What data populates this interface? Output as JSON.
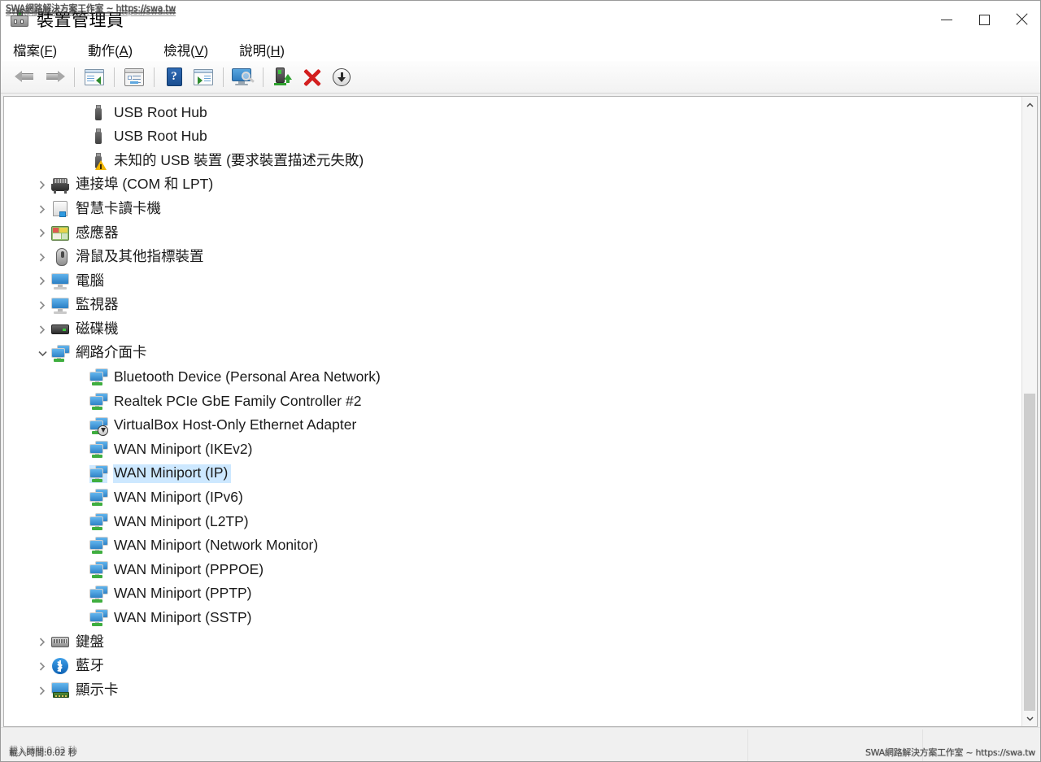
{
  "window": {
    "title": "裝置管理員",
    "icon": "device-manager-icon",
    "controls": {
      "minimize": "—",
      "maximize": "□",
      "close": "✕"
    }
  },
  "menubar": {
    "items": [
      {
        "label": "檔案",
        "accesskey": "F"
      },
      {
        "label": "動作",
        "accesskey": "A"
      },
      {
        "label": "檢視",
        "accesskey": "V"
      },
      {
        "label": "說明",
        "accesskey": "H"
      }
    ]
  },
  "toolbar": {
    "buttons": [
      {
        "name": "back-button",
        "icon": "back-arrow-icon"
      },
      {
        "name": "forward-button",
        "icon": "forward-arrow-icon"
      },
      {
        "name": "show-hide-console-tree",
        "icon": "console-tree-icon"
      },
      {
        "name": "properties-button",
        "icon": "properties-icon"
      },
      {
        "name": "help-button",
        "icon": "help-icon"
      },
      {
        "name": "show-hide-action-pane",
        "icon": "action-pane-icon"
      },
      {
        "name": "scan-hardware-changes",
        "icon": "scan-hardware-icon"
      },
      {
        "name": "update-driver-button",
        "icon": "update-driver-icon"
      },
      {
        "name": "uninstall-device-button",
        "icon": "red-x-icon"
      },
      {
        "name": "disable-device-button",
        "icon": "down-arrow-circle-icon"
      }
    ]
  },
  "tree": {
    "rows": [
      {
        "label": "USB Root Hub",
        "icon": "usb-icon",
        "level": 2,
        "expander": "none",
        "selected": false
      },
      {
        "label": "USB Root Hub",
        "icon": "usb-icon",
        "level": 2,
        "expander": "none",
        "selected": false
      },
      {
        "label": "未知的 USB 裝置 (要求裝置描述元失敗)",
        "icon": "usb-warning-icon",
        "level": 2,
        "expander": "none",
        "selected": false
      },
      {
        "label": "連接埠 (COM 和 LPT)",
        "icon": "port-icon",
        "level": 1,
        "expander": "collapsed",
        "selected": false
      },
      {
        "label": "智慧卡讀卡機",
        "icon": "smartcard-icon",
        "level": 1,
        "expander": "collapsed",
        "selected": false
      },
      {
        "label": "感應器",
        "icon": "sensor-icon",
        "level": 1,
        "expander": "collapsed",
        "selected": false
      },
      {
        "label": "滑鼠及其他指標裝置",
        "icon": "mouse-icon",
        "level": 1,
        "expander": "collapsed",
        "selected": false
      },
      {
        "label": "電腦",
        "icon": "computer-icon",
        "level": 1,
        "expander": "collapsed",
        "selected": false
      },
      {
        "label": "監視器",
        "icon": "monitor-icon",
        "level": 1,
        "expander": "collapsed",
        "selected": false
      },
      {
        "label": "磁碟機",
        "icon": "disk-drive-icon",
        "level": 1,
        "expander": "collapsed",
        "selected": false
      },
      {
        "label": "網路介面卡",
        "icon": "network-icon",
        "level": 1,
        "expander": "expanded",
        "selected": false
      },
      {
        "label": "Bluetooth Device (Personal Area Network)",
        "icon": "network-icon",
        "level": 2,
        "expander": "none",
        "selected": false
      },
      {
        "label": "Realtek PCIe GbE Family Controller #2",
        "icon": "network-icon",
        "level": 2,
        "expander": "none",
        "selected": false
      },
      {
        "label": "VirtualBox Host-Only Ethernet Adapter",
        "icon": "network-disabled-icon",
        "level": 2,
        "expander": "none",
        "selected": false
      },
      {
        "label": "WAN Miniport (IKEv2)",
        "icon": "network-icon",
        "level": 2,
        "expander": "none",
        "selected": false
      },
      {
        "label": "WAN Miniport (IP)",
        "icon": "network-icon",
        "level": 2,
        "expander": "none",
        "selected": true
      },
      {
        "label": "WAN Miniport (IPv6)",
        "icon": "network-icon",
        "level": 2,
        "expander": "none",
        "selected": false
      },
      {
        "label": "WAN Miniport (L2TP)",
        "icon": "network-icon",
        "level": 2,
        "expander": "none",
        "selected": false
      },
      {
        "label": "WAN Miniport (Network Monitor)",
        "icon": "network-icon",
        "level": 2,
        "expander": "none",
        "selected": false
      },
      {
        "label": "WAN Miniport (PPPOE)",
        "icon": "network-icon",
        "level": 2,
        "expander": "none",
        "selected": false
      },
      {
        "label": "WAN Miniport (PPTP)",
        "icon": "network-icon",
        "level": 2,
        "expander": "none",
        "selected": false
      },
      {
        "label": "WAN Miniport (SSTP)",
        "icon": "network-icon",
        "level": 2,
        "expander": "none",
        "selected": false
      },
      {
        "label": "鍵盤",
        "icon": "keyboard-icon",
        "level": 1,
        "expander": "collapsed",
        "selected": false
      },
      {
        "label": "藍牙",
        "icon": "bluetooth-icon",
        "level": 1,
        "expander": "collapsed",
        "selected": false
      },
      {
        "label": "顯示卡",
        "icon": "display-adapter-icon",
        "level": 1,
        "expander": "collapsed",
        "selected": false
      }
    ]
  },
  "scrollbar": {
    "up": "▲",
    "down": "▼"
  },
  "statusbar": {
    "text": ""
  },
  "watermarks": {
    "top": "SWA網路解決方案工作室 ~ https://swa.tw",
    "bottom": "SWA網路解決方案工作室 ~ https://swa.tw",
    "status": "載入時間:0.02 秒"
  },
  "colors": {
    "selection": "#cde8ff",
    "accent": "#2f82c6",
    "window_bg": "#f0f0f0"
  }
}
